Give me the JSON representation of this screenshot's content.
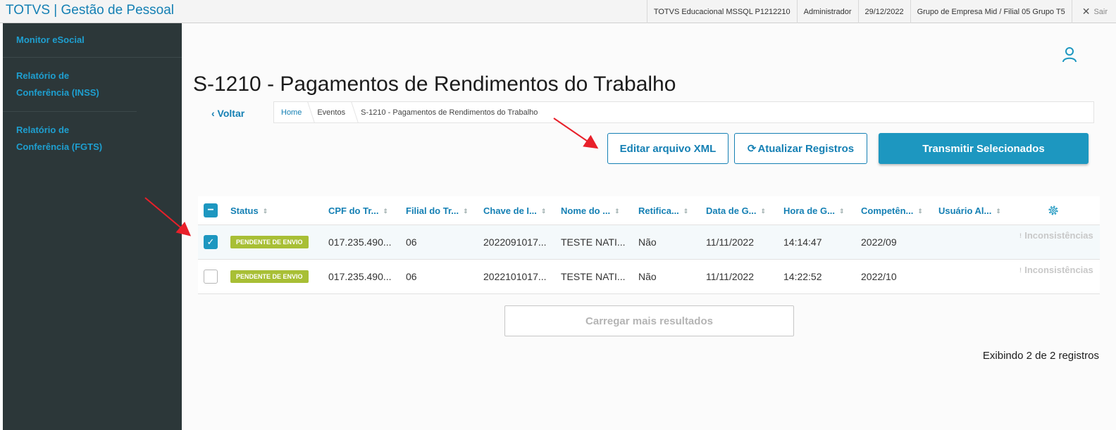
{
  "app": {
    "title": "TOTVS | Gestão de Pessoal"
  },
  "topinfo": {
    "system": "TOTVS Educacional MSSQL P1212210",
    "user": "Administrador",
    "date": "29/12/2022",
    "company": "Grupo de Empresa Mid / Filial 05 Grupo T5",
    "exit": "Sair"
  },
  "sidebar": {
    "items": [
      {
        "label": "Monitor eSocial"
      },
      {
        "label": "Relatório de Conferência (INSS)"
      },
      {
        "label": "Relatório de Conferência (FGTS)"
      }
    ]
  },
  "page": {
    "title": "S-1210 - Pagamentos de Rendimentos do Trabalho",
    "back": "‹ Voltar"
  },
  "breadcrumb": [
    "Home",
    "Eventos",
    "S-1210 - Pagamentos de Rendimentos do Trabalho"
  ],
  "actions": {
    "edit_xml": "Editar arquivo XML",
    "refresh": "Atualizar Registros",
    "transmit": "Transmitir Selecionados"
  },
  "table": {
    "columns": [
      "Status",
      "CPF do Tr...",
      "Filial do Tr...",
      "Chave de I...",
      "Nome do ...",
      "Retifica...",
      "Data de G...",
      "Hora de G...",
      "Competên...",
      "Usuário Al..."
    ],
    "rows": [
      {
        "selected": true,
        "status": "PENDENTE DE ENVIO",
        "cpf": "017.235.490...",
        "filial": "06",
        "chave": "2022091017...",
        "nome": "TESTE NATI...",
        "retificacao": "Não",
        "data": "11/11/2022",
        "hora": "14:14:47",
        "competencia": "2022/09",
        "usuario": "",
        "inconsistencias": "Inconsistências"
      },
      {
        "selected": false,
        "status": "PENDENTE DE ENVIO",
        "cpf": "017.235.490...",
        "filial": "06",
        "chave": "2022101017...",
        "nome": "TESTE NATI...",
        "retificacao": "Não",
        "data": "11/11/2022",
        "hora": "14:22:52",
        "competencia": "2022/10",
        "usuario": "",
        "inconsistencias": "Inconsistências"
      }
    ]
  },
  "footer": {
    "load_more": "Carregar mais resultados",
    "records": "Exibindo 2 de 2 registros"
  },
  "colors": {
    "brand": "#1580b4",
    "primary": "#1d97c0",
    "sidebar": "#2c3739",
    "status_pending": "#a8bf35",
    "annotation": "#e8202a"
  },
  "icons": [
    "user-icon",
    "refresh-icon",
    "gear-icon",
    "close-icon",
    "sort-icon",
    "checkbox-icon"
  ]
}
